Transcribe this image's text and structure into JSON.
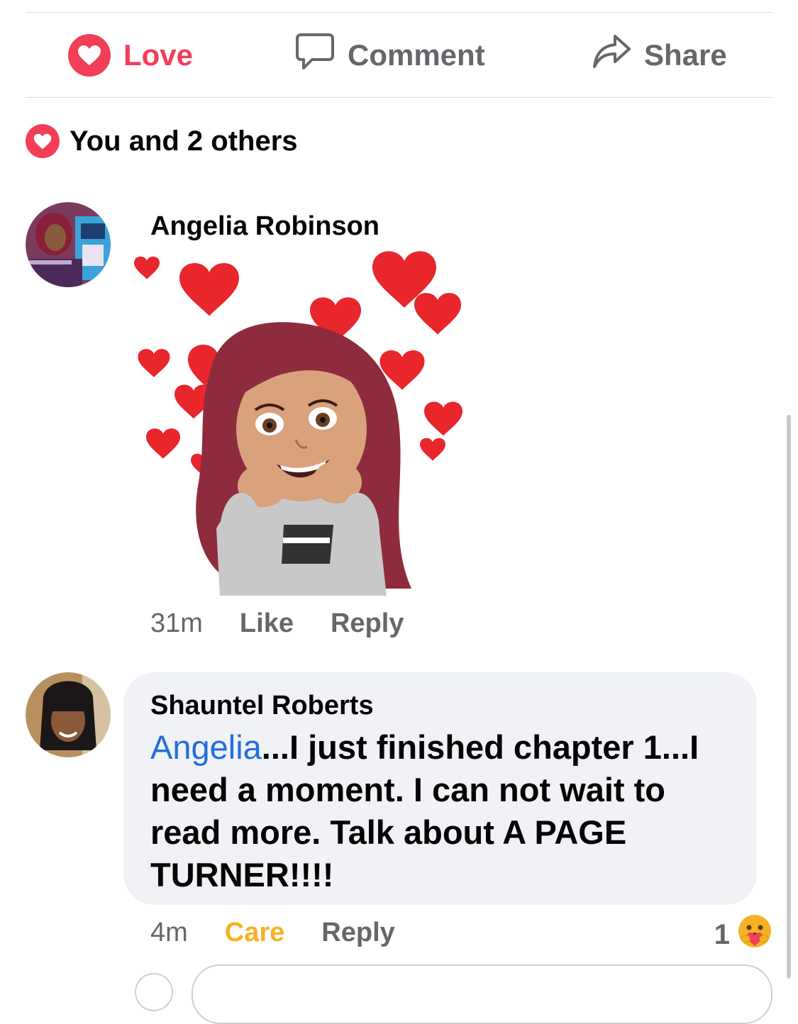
{
  "actions": {
    "love": "Love",
    "comment": "Comment",
    "share": "Share"
  },
  "reactions": {
    "summary": "You and 2 others"
  },
  "comments": [
    {
      "author": "Angelia Robinson",
      "sticker": "avatar sticker with hearts",
      "time": "31m",
      "like": "Like",
      "reply": "Reply"
    },
    {
      "author": "Shauntel Roberts",
      "mention": "Angelia",
      "text": "...I just finished chapter 1...I need a moment. I can not wait to read more. Talk about A PAGE TURNER!!!!",
      "time": "4m",
      "reaction": "Care",
      "reply": "Reply",
      "reaction_count": "1"
    }
  ],
  "colors": {
    "love": "#f33e58",
    "care": "#f7b125",
    "mention": "#216fdb",
    "muted": "#65676b",
    "bubble": "#f0f2f5"
  }
}
